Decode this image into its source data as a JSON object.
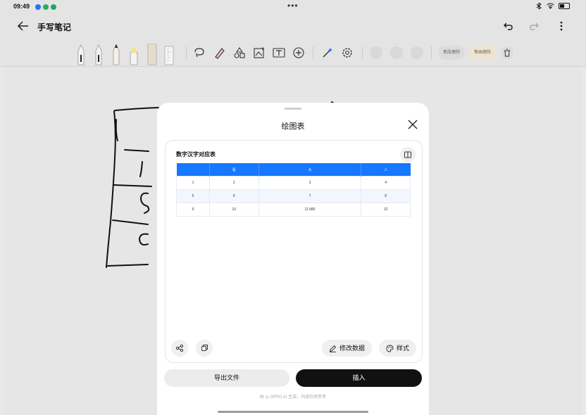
{
  "status_bar": {
    "time": "09:49",
    "center": "•••"
  },
  "header": {
    "title": "手写笔记"
  },
  "toolbar": {
    "chip1": "笔段擦除",
    "chip2": "笔画擦除"
  },
  "dialog": {
    "title": "绘图表",
    "card_title": "数字汉字对应表",
    "table": {
      "headers": [
        "",
        "看",
        "大",
        "人"
      ],
      "rows": [
        [
          "1",
          "2",
          "3",
          "4"
        ],
        [
          "5",
          "6",
          "7",
          "8"
        ],
        [
          "9",
          "10",
          "11 580",
          "12"
        ]
      ]
    },
    "edit_label": "修改数据",
    "style_label": "样式",
    "export_label": "导出文件",
    "insert_label": "插入",
    "footnote": "由 ◎ OPPO AI 生成，内容仅供参考"
  },
  "colors": {
    "accent": "#1677ff",
    "primary_button": "#111111",
    "chip_bg": "#efe4cf"
  },
  "icons": [
    "back-icon",
    "undo-icon",
    "redo-icon",
    "more-icon",
    "lasso-icon",
    "eraser-icon",
    "shapes-icon",
    "image-icon",
    "text-icon",
    "add-icon",
    "magic-icon",
    "settings-icon",
    "delete-icon",
    "close-icon",
    "split-view-icon",
    "share-icon",
    "copy-icon",
    "edit-icon",
    "palette-icon"
  ]
}
